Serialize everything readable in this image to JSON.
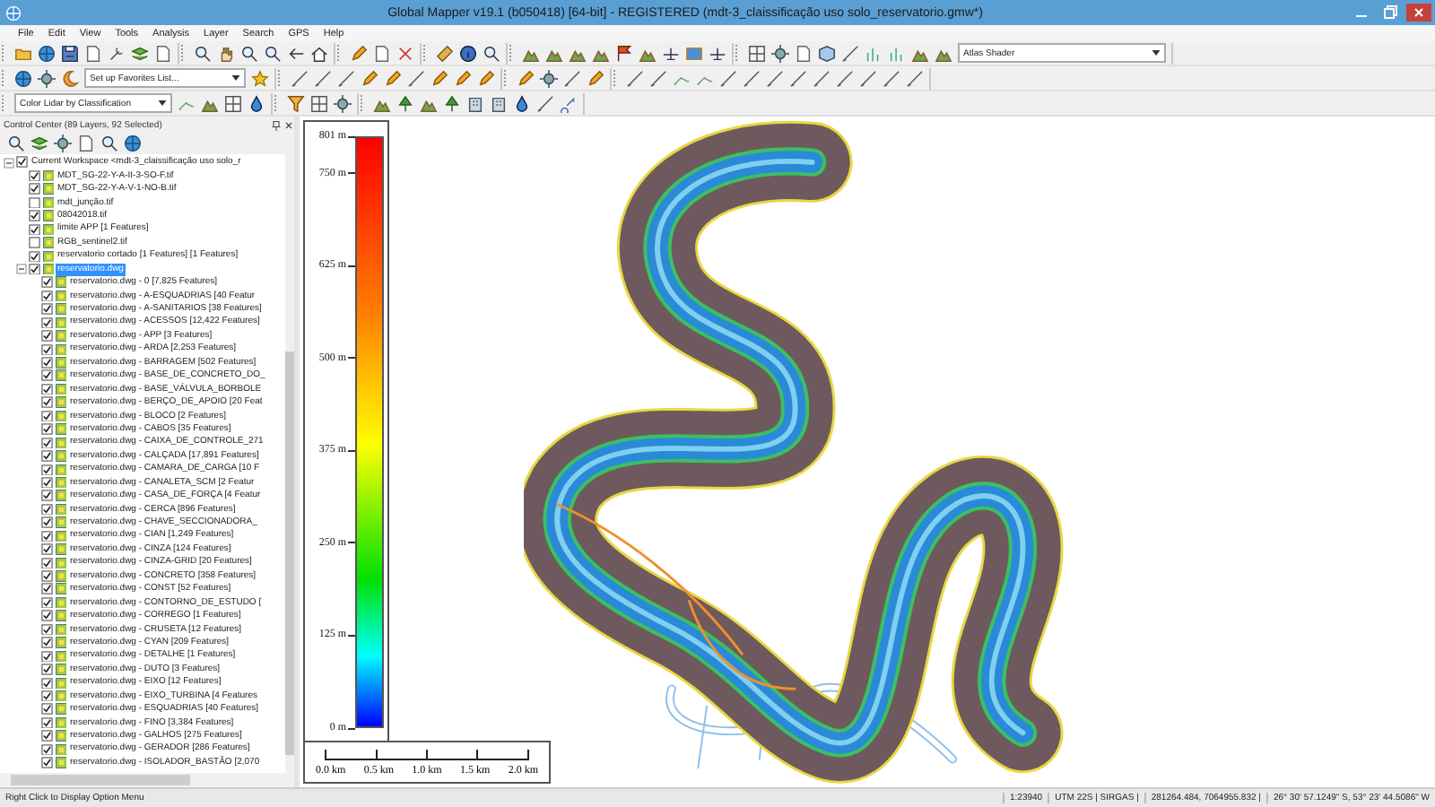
{
  "window": {
    "title": "Global Mapper v19.1 (b050418) [64-bit] - REGISTERED (mdt-3_claissificação uso solo_reservatorio.gmw*)"
  },
  "menu": [
    "File",
    "Edit",
    "View",
    "Tools",
    "Analysis",
    "Layer",
    "Search",
    "GPS",
    "Help"
  ],
  "toolbars": [
    {
      "dropdown": "Atlas Shader"
    },
    {
      "dropdown": "Set up Favorites List..."
    },
    {
      "dropdown": "Color Lidar by Classification"
    }
  ],
  "control_center": {
    "title": "Control Center (89 Layers, 92 Selected)",
    "layers": [
      {
        "label": "Current Workspace <mdt-3_claissificação uso solo_r",
        "checked": true,
        "selected": false,
        "expanded": true,
        "children": [
          {
            "label": "MDT_SG-22-Y-A-II-3-SO-F.tif",
            "checked": true,
            "selected": false
          },
          {
            "label": "MDT_SG-22-Y-A-V-1-NO-B.tif",
            "checked": true,
            "selected": false
          },
          {
            "label": "mdt_junção.tif",
            "checked": false,
            "selected": false
          },
          {
            "label": "08042018.tif",
            "checked": true,
            "selected": false
          },
          {
            "label": "limite APP [1 Features]",
            "checked": true,
            "selected": false
          },
          {
            "label": "RGB_sentinel2.tif",
            "checked": false,
            "selected": false
          },
          {
            "label": "reservatorio cortado [1 Features] [1 Features]",
            "checked": true,
            "selected": false
          },
          {
            "label": "reservatorio.dwg",
            "checked": true,
            "selected": true,
            "expanded": true,
            "children": [
              {
                "label": "reservatorio.dwg - 0 [7,825 Features]",
                "checked": true,
                "selected": false
              },
              {
                "label": "reservatorio.dwg - A-ESQUADRIAS [40 Featur",
                "checked": true,
                "selected": false
              },
              {
                "label": "reservatorio.dwg - A-SANITARIOS [38 Features]",
                "checked": true,
                "selected": false
              },
              {
                "label": "reservatorio.dwg - ACESSOS [12,422 Features]",
                "checked": true,
                "selected": false
              },
              {
                "label": "reservatorio.dwg - APP [3 Features]",
                "checked": true,
                "selected": false
              },
              {
                "label": "reservatorio.dwg - ARDA [2,253 Features]",
                "checked": true,
                "selected": false
              },
              {
                "label": "reservatorio.dwg - BARRAGEM [502 Features]",
                "checked": true,
                "selected": false
              },
              {
                "label": "reservatorio.dwg - BASE_DE_CONCRETO_DO_",
                "checked": true,
                "selected": false
              },
              {
                "label": "reservatorio.dwg - BASE_VÁLVULA_BORBOLE",
                "checked": true,
                "selected": false
              },
              {
                "label": "reservatorio.dwg - BERÇO_DE_APOIO [20 Feat",
                "checked": true,
                "selected": false
              },
              {
                "label": "reservatorio.dwg - BLOCO [2 Features]",
                "checked": true,
                "selected": false
              },
              {
                "label": "reservatorio.dwg - CABOS [35 Features]",
                "checked": true,
                "selected": false
              },
              {
                "label": "reservatorio.dwg - CAIXA_DE_CONTROLE_271",
                "checked": true,
                "selected": false
              },
              {
                "label": "reservatorio.dwg - CALÇADA [17,891 Features]",
                "checked": true,
                "selected": false
              },
              {
                "label": "reservatorio.dwg - CAMARA_DE_CARGA [10 F",
                "checked": true,
                "selected": false
              },
              {
                "label": "reservatorio.dwg - CANALETA_SCM [2 Featur",
                "checked": true,
                "selected": false
              },
              {
                "label": "reservatorio.dwg - CASA_DE_FORÇA [4 Featur",
                "checked": true,
                "selected": false
              },
              {
                "label": "reservatorio.dwg - CERCA [896 Features]",
                "checked": true,
                "selected": false
              },
              {
                "label": "reservatorio.dwg - CHAVE_SECCIONADORA_",
                "checked": true,
                "selected": false
              },
              {
                "label": "reservatorio.dwg - CIAN [1,249 Features]",
                "checked": true,
                "selected": false
              },
              {
                "label": "reservatorio.dwg - CINZA [124 Features]",
                "checked": true,
                "selected": false
              },
              {
                "label": "reservatorio.dwg - CINZA-GRID [20 Features]",
                "checked": true,
                "selected": false
              },
              {
                "label": "reservatorio.dwg - CONCRETO [358 Features]",
                "checked": true,
                "selected": false
              },
              {
                "label": "reservatorio.dwg - CONST [52 Features]",
                "checked": true,
                "selected": false
              },
              {
                "label": "reservatorio.dwg - CONTORNO_DE_ESTUDO [",
                "checked": true,
                "selected": false
              },
              {
                "label": "reservatorio.dwg - CORREGO [1 Features]",
                "checked": true,
                "selected": false
              },
              {
                "label": "reservatorio.dwg - CRUSETA [12 Features]",
                "checked": true,
                "selected": false
              },
              {
                "label": "reservatorio.dwg - CYAN [209 Features]",
                "checked": true,
                "selected": false
              },
              {
                "label": "reservatorio.dwg - DETALHE [1 Features]",
                "checked": true,
                "selected": false
              },
              {
                "label": "reservatorio.dwg - DUTO [3 Features]",
                "checked": true,
                "selected": false
              },
              {
                "label": "reservatorio.dwg - EIXO [12 Features]",
                "checked": true,
                "selected": false
              },
              {
                "label": "reservatorio.dwg - EIXO_TURBINA [4 Features",
                "checked": true,
                "selected": false
              },
              {
                "label": "reservatorio.dwg - ESQUADRIAS [40 Features]",
                "checked": true,
                "selected": false
              },
              {
                "label": "reservatorio.dwg - FINO [3,384 Features]",
                "checked": true,
                "selected": false
              },
              {
                "label": "reservatorio.dwg - GALHOS [275 Features]",
                "checked": true,
                "selected": false
              },
              {
                "label": "reservatorio.dwg - GERADOR [286 Features]",
                "checked": true,
                "selected": false
              },
              {
                "label": "reservatorio.dwg - ISOLADOR_BASTÃO [2,070",
                "checked": true,
                "selected": false
              }
            ]
          }
        ]
      }
    ]
  },
  "legend": {
    "ticks": [
      "801 m",
      "750 m",
      "625 m",
      "500 m",
      "375 m",
      "250 m",
      "125 m",
      "0 m"
    ]
  },
  "scale_bar": {
    "ticks": [
      "0.0 km",
      "0.5 km",
      "1.0 km",
      "1.5 km",
      "2.0 km"
    ]
  },
  "status_bar": {
    "hint": "Right Click to Display Option Menu",
    "fields": [
      "1:23940",
      "UTM 22S | SIRGAS |",
      "281264.484, 7064955.832 |",
      "26° 30' 57.1249\" S, 53° 23' 44.5086\" W"
    ]
  }
}
